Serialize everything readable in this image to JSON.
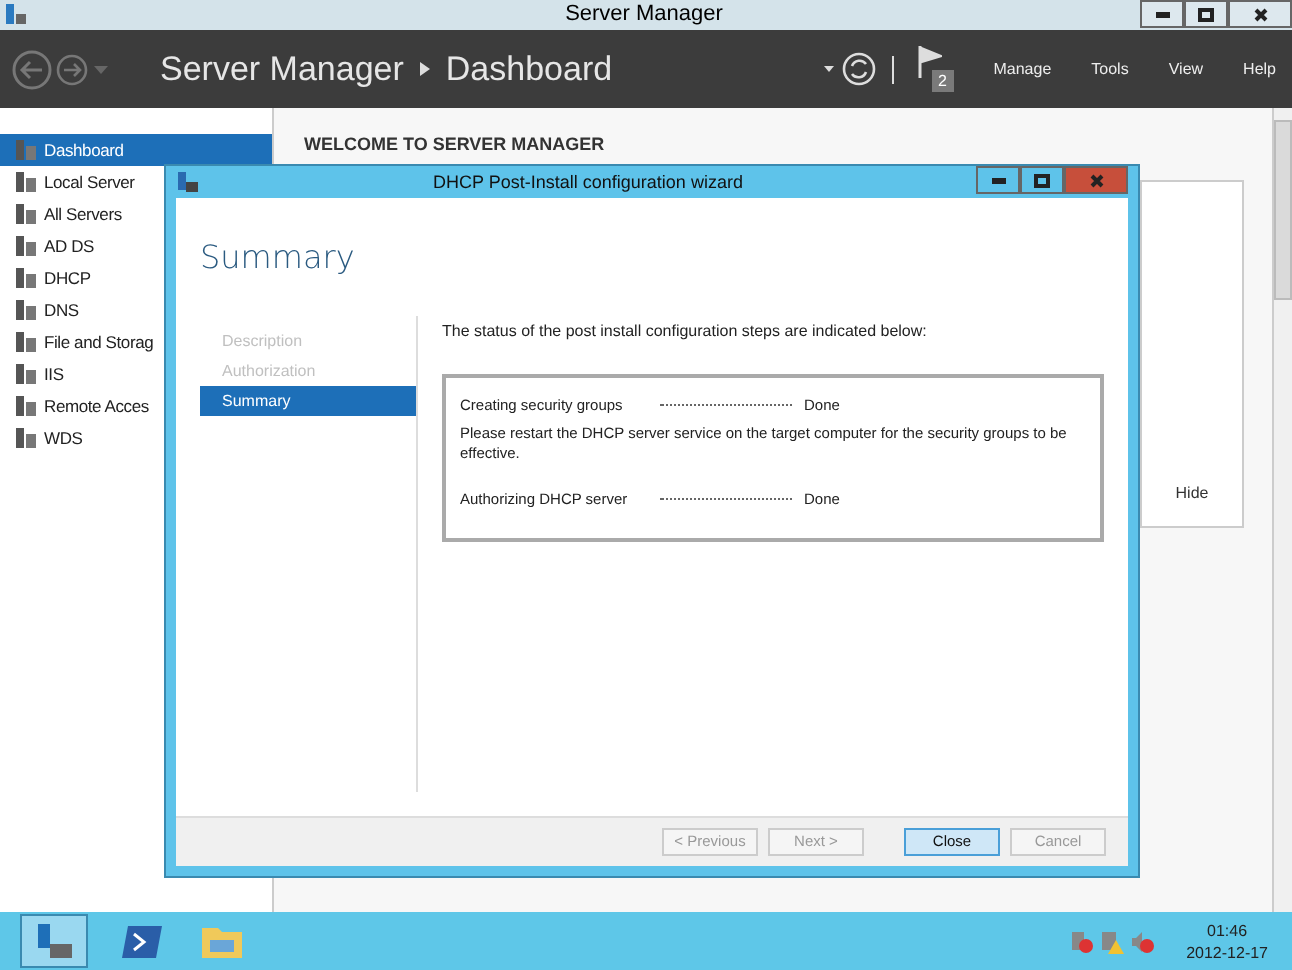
{
  "window": {
    "title": "Server Manager"
  },
  "header": {
    "app": "Server Manager",
    "page": "Dashboard",
    "notifications": "2",
    "menu": [
      "Manage",
      "Tools",
      "View",
      "Help"
    ]
  },
  "sidebar": {
    "items": [
      {
        "label": "Dashboard",
        "selected": true
      },
      {
        "label": "Local Server",
        "selected": false
      },
      {
        "label": "All Servers",
        "selected": false
      },
      {
        "label": "AD DS",
        "selected": false
      },
      {
        "label": "DHCP",
        "selected": false
      },
      {
        "label": "DNS",
        "selected": false
      },
      {
        "label": "File and Storag",
        "selected": false
      },
      {
        "label": "IIS",
        "selected": false
      },
      {
        "label": "Remote Acces",
        "selected": false
      },
      {
        "label": "WDS",
        "selected": false
      }
    ]
  },
  "main": {
    "heading": "WELCOME TO SERVER MANAGER",
    "hide": "Hide"
  },
  "dialog": {
    "title": "DHCP Post-Install configuration wizard",
    "heading": "Summary",
    "steps": [
      {
        "label": "Description",
        "selected": false
      },
      {
        "label": "Authorization",
        "selected": false
      },
      {
        "label": "Summary",
        "selected": true
      }
    ],
    "intro": "The status of the post install configuration steps are indicated below:",
    "status": [
      {
        "kind": "step",
        "label": "Creating security groups",
        "result": "Done"
      },
      {
        "kind": "note",
        "text": "Please restart the DHCP server service on the target computer for the security groups to be effective."
      },
      {
        "kind": "step",
        "label": "Authorizing DHCP server",
        "result": "Done"
      }
    ],
    "buttons": [
      {
        "label": "< Previous",
        "disabled": true,
        "default": false
      },
      {
        "label": "Next >",
        "disabled": true,
        "default": false
      },
      {
        "label": "Close",
        "disabled": false,
        "default": true
      },
      {
        "label": "Cancel",
        "disabled": true,
        "default": false
      }
    ]
  },
  "taskbar": {
    "time": "01:46",
    "date": "2012-12-17"
  }
}
